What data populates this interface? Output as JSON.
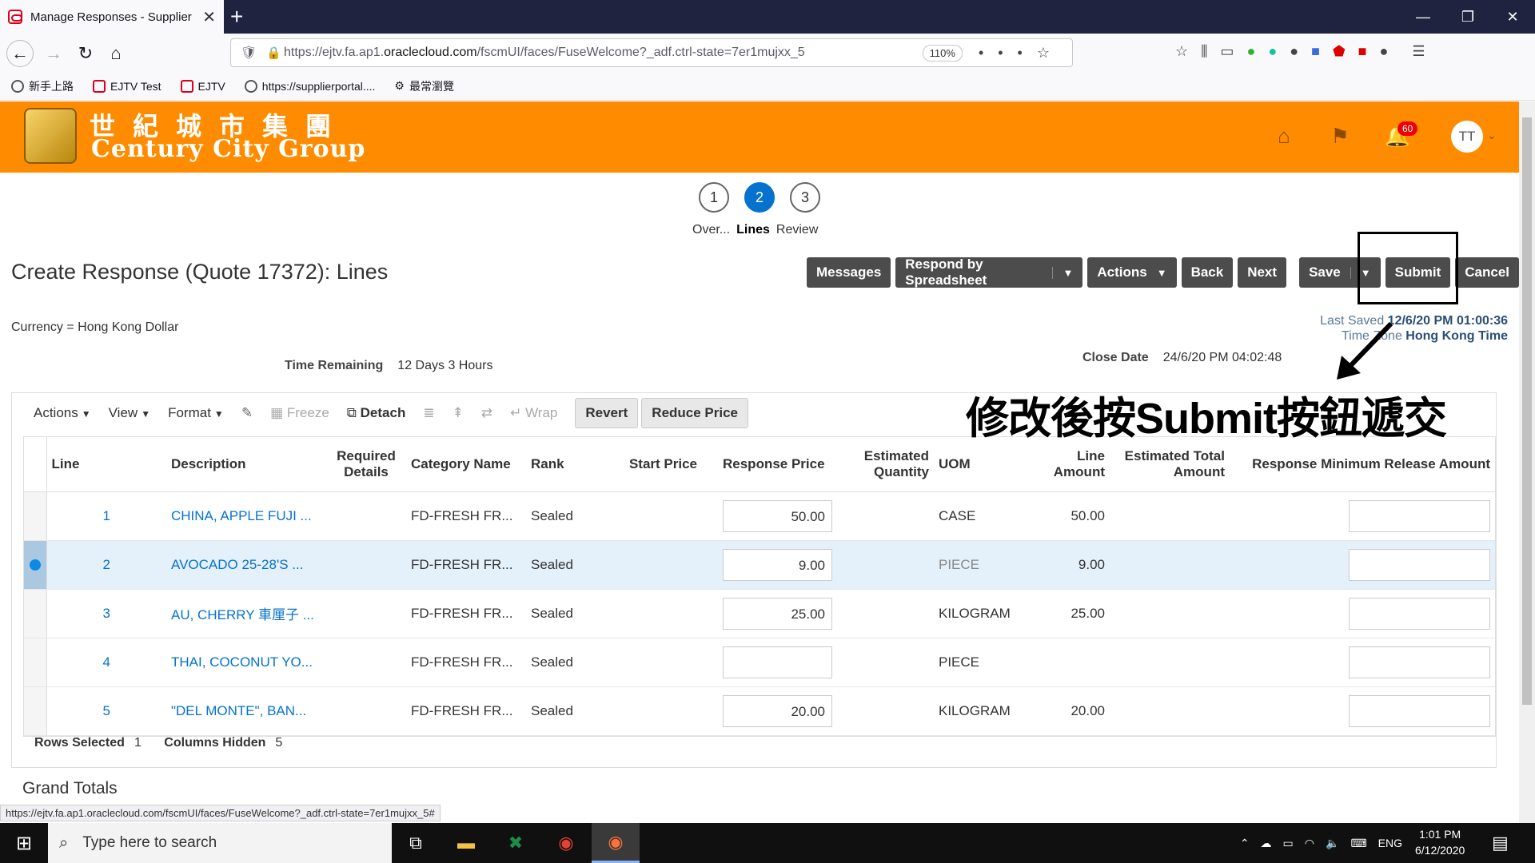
{
  "browser": {
    "tab_title": "Manage Responses - Supplier P",
    "url_prefix": "https://ejtv.fa.ap1.",
    "url_domain": "oraclecloud.com",
    "url_rest": "/fscmUI/faces/FuseWelcome?_adf.ctrl-state=7er1mujxx_5",
    "zoom": "110%",
    "bookmarks": [
      "新手上路",
      "EJTV Test",
      "EJTV",
      "https://supplierportal....",
      "最常瀏覽"
    ]
  },
  "header": {
    "logo_zh": "世紀城市集團",
    "logo_en": "Century City Group",
    "notification_count": "60",
    "avatar_initials": "TT"
  },
  "train": {
    "stops": [
      "1",
      "2",
      "3"
    ],
    "labels": [
      "Over...",
      "Lines",
      "Review"
    ]
  },
  "page": {
    "title": "Create Response (Quote 17372): Lines",
    "currency": "Currency = Hong Kong Dollar",
    "last_saved_label": "Last Saved",
    "last_saved_value": "12/6/20 PM 01:00:36",
    "time_zone_label": "Time Zone",
    "time_zone_value": "Hong Kong Time",
    "time_remaining_label": "Time Remaining",
    "time_remaining_value": "12 Days 3 Hours",
    "close_date_label": "Close Date",
    "close_date_value": "24/6/20 PM 04:02:48",
    "annotation": "修改後按Submit按鈕遞交"
  },
  "buttons": {
    "messages": "Messages",
    "respond_spreadsheet": "Respond by Spreadsheet",
    "actions": "Actions",
    "back": "Back",
    "next": "Next",
    "save": "Save",
    "submit": "Submit",
    "cancel": "Cancel"
  },
  "toolbar": {
    "actions": "Actions",
    "view": "View",
    "format": "Format",
    "freeze": "Freeze",
    "detach": "Detach",
    "wrap": "Wrap",
    "revert": "Revert",
    "reduce_price": "Reduce Price"
  },
  "table": {
    "headers": {
      "line": "Line",
      "description": "Description",
      "required_details": "Required Details",
      "category": "Category Name",
      "rank": "Rank",
      "start_price": "Start Price",
      "response_price": "Response Price",
      "est_qty": "Estimated Quantity",
      "uom": "UOM",
      "line_amount": "Line Amount",
      "est_total": "Estimated Total Amount",
      "min_release": "Response Minimum Release Amount"
    },
    "rows": [
      {
        "line": "1",
        "description": "CHINA, APPLE FUJI ...",
        "category": "FD-FRESH FR...",
        "rank": "Sealed",
        "response_price": "50.00",
        "uom": "CASE",
        "line_amount": "50.00"
      },
      {
        "line": "2",
        "description": "AVOCADO 25-28'S ...",
        "category": "FD-FRESH FR...",
        "rank": "Sealed",
        "response_price": "9.00",
        "uom": "PIECE",
        "line_amount": "9.00"
      },
      {
        "line": "3",
        "description": "AU, CHERRY 車厘子 ...",
        "category": "FD-FRESH FR...",
        "rank": "Sealed",
        "response_price": "25.00",
        "uom": "KILOGRAM",
        "line_amount": "25.00"
      },
      {
        "line": "4",
        "description": "THAI, COCONUT YO...",
        "category": "FD-FRESH FR...",
        "rank": "Sealed",
        "response_price": "",
        "uom": "PIECE",
        "line_amount": ""
      },
      {
        "line": "5",
        "description": "\"DEL MONTE\", BAN...",
        "category": "FD-FRESH FR...",
        "rank": "Sealed",
        "response_price": "20.00",
        "uom": "KILOGRAM",
        "line_amount": "20.00"
      }
    ],
    "rows_selected_label": "Rows Selected",
    "rows_selected_value": "1",
    "columns_hidden_label": "Columns Hidden",
    "columns_hidden_value": "5"
  },
  "grand_totals": "Grand Totals",
  "status_url": "https://ejtv.fa.ap1.oraclecloud.com/fscmUI/faces/FuseWelcome?_adf.ctrl-state=7er1mujxx_5#",
  "taskbar": {
    "search_placeholder": "Type here to search",
    "lang": "ENG",
    "time": "1:01 PM",
    "date": "6/12/2020"
  }
}
